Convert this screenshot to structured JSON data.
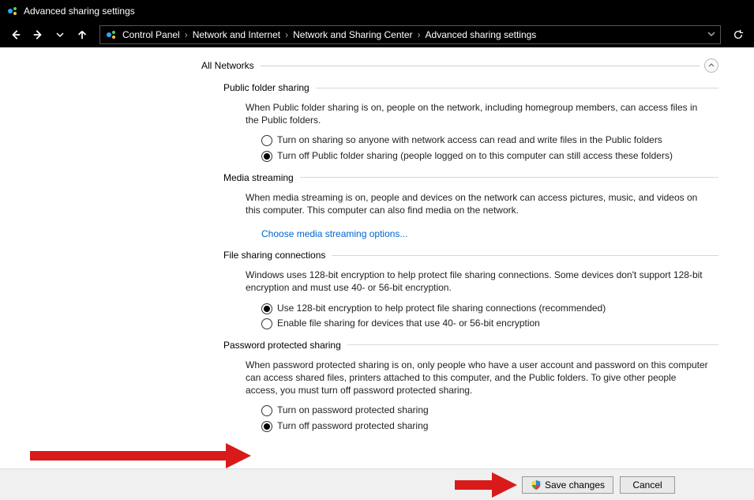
{
  "window": {
    "title": "Advanced sharing settings"
  },
  "breadcrumb": {
    "items": [
      "Control Panel",
      "Network and Internet",
      "Network and Sharing Center",
      "Advanced sharing settings"
    ]
  },
  "section": {
    "title": "All Networks"
  },
  "public_folder": {
    "title": "Public folder sharing",
    "desc": "When Public folder sharing is on, people on the network, including homegroup members, can access files in the Public folders.",
    "opt1": "Turn on sharing so anyone with network access can read and write files in the Public folders",
    "opt2": "Turn off Public folder sharing (people logged on to this computer can still access these folders)",
    "selected": 2
  },
  "media_streaming": {
    "title": "Media streaming",
    "desc": "When media streaming is on, people and devices on the network can access pictures, music, and videos on this computer. This computer can also find media on the network.",
    "link": "Choose media streaming options..."
  },
  "file_sharing": {
    "title": "File sharing connections",
    "desc": "Windows uses 128-bit encryption to help protect file sharing connections. Some devices don't support 128-bit encryption and must use 40- or 56-bit encryption.",
    "opt1": "Use 128-bit encryption to help protect file sharing connections (recommended)",
    "opt2": "Enable file sharing for devices that use 40- or 56-bit encryption",
    "selected": 1
  },
  "password": {
    "title": "Password protected sharing",
    "desc": "When password protected sharing is on, only people who have a user account and password on this computer can access shared files, printers attached to this computer, and the Public folders. To give other people access, you must turn off password protected sharing.",
    "opt1": "Turn on password protected sharing",
    "opt2": "Turn off password protected sharing",
    "selected": 2
  },
  "footer": {
    "save": "Save changes",
    "cancel": "Cancel"
  }
}
